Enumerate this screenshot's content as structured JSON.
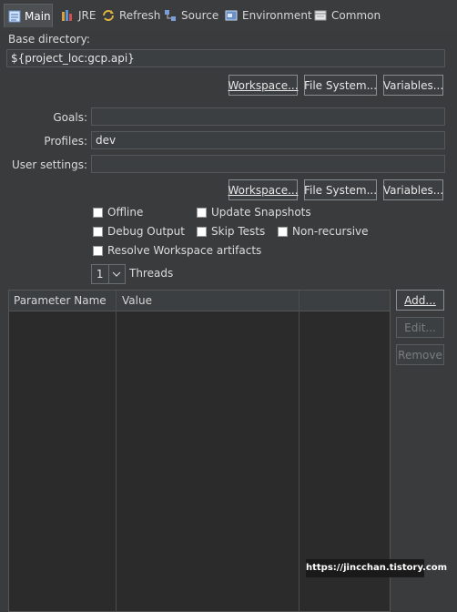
{
  "tabs": [
    {
      "label": "Main",
      "icon": "main-tab-icon",
      "active": true
    },
    {
      "label": "JRE",
      "icon": "jre-icon"
    },
    {
      "label": "Refresh",
      "icon": "refresh-icon"
    },
    {
      "label": "Source",
      "icon": "source-icon"
    },
    {
      "label": "Environment",
      "icon": "environment-icon"
    },
    {
      "label": "Common",
      "icon": "common-icon"
    }
  ],
  "base_directory": {
    "label": "Base directory:",
    "value": "${project_loc:gcp.api}"
  },
  "buttons_row1": {
    "workspace": "Workspace...",
    "file_system": "File System...",
    "variables": "Variables..."
  },
  "goals": {
    "label": "Goals:",
    "value": ""
  },
  "profiles": {
    "label": "Profiles:",
    "value": "dev"
  },
  "user_settings": {
    "label": "User settings:",
    "value": ""
  },
  "buttons_row2": {
    "workspace": "Workspace...",
    "file_system": "File System...",
    "variables": "Variables..."
  },
  "options": {
    "offline": "Offline",
    "update_snapshots": "Update Snapshots",
    "debug_output": "Debug Output",
    "skip_tests": "Skip Tests",
    "non_recursive": "Non-recursive",
    "resolve_workspace": "Resolve Workspace artifacts"
  },
  "threads": {
    "value": "1",
    "label": "Threads"
  },
  "parameters_table": {
    "columns": [
      "Parameter Name",
      "Value"
    ]
  },
  "table_buttons": {
    "add": "Add...",
    "edit": "Edit...",
    "remove": "Remove"
  },
  "watermark": "https://jincchan.tistory.com"
}
